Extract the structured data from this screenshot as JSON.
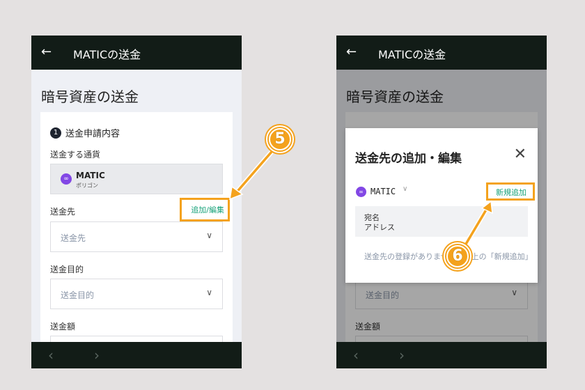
{
  "left": {
    "header": {
      "title": "MATICの送金"
    },
    "page_title": "暗号資産の送金",
    "step": {
      "number": "1",
      "label": "送金申請内容"
    },
    "currency_label": "送金する通貨",
    "currency": {
      "name": "MATIC",
      "sub": "ポリゴン"
    },
    "destination_label": "送金先",
    "add_edit_link": "追加/編集",
    "destination_placeholder": "送金先",
    "purpose_label": "送金目的",
    "purpose_placeholder": "送金目的",
    "amount_label": "送金額"
  },
  "right": {
    "header": {
      "title": "MATICの送金"
    },
    "page_title": "暗号資産の送金",
    "modal": {
      "title": "送金先の追加・編集",
      "coin": "MATIC",
      "new_add": "新規追加",
      "col_name": "宛名",
      "col_address": "アドレス",
      "empty_message": "送金先の登録がありません。右上の「新規追加」"
    },
    "purpose_placeholder": "送金目的",
    "amount_label": "送金額"
  },
  "badges": {
    "step5": "5",
    "step6": "6"
  },
  "icons": {
    "back": "back-arrow-icon",
    "close": "close-icon",
    "coin": "polygon-coin-icon",
    "chevron": "chevron-down-icon",
    "nav_back": "nav-back-icon",
    "nav_forward": "nav-forward-icon"
  },
  "colors": {
    "header": "#121c17",
    "accent_link": "#1aa37a",
    "highlight": "#f4a21d",
    "polygon": "#8247e5"
  }
}
